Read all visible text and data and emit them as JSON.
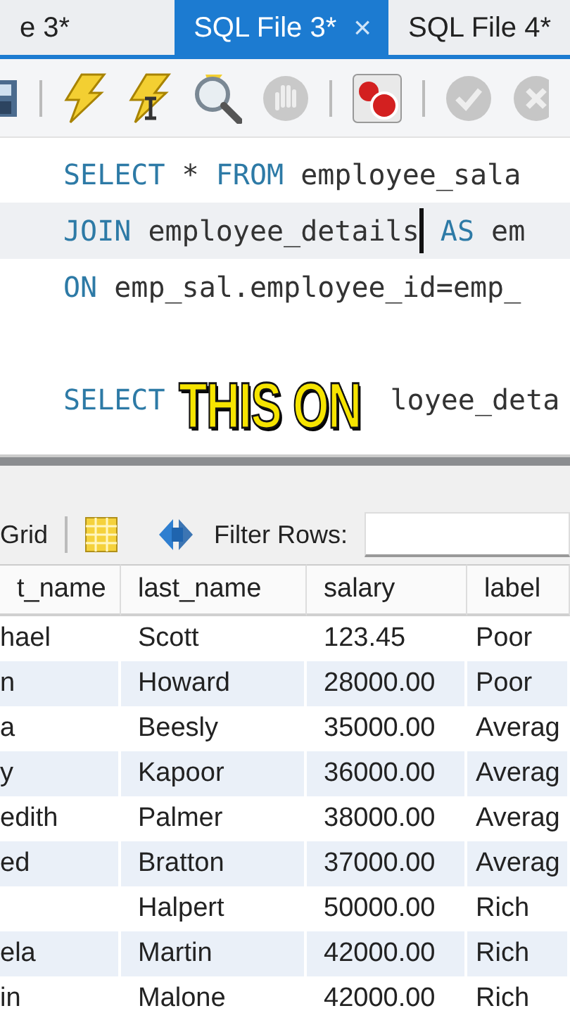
{
  "tabs": [
    {
      "label": "e 3*",
      "selected": false,
      "closable": false
    },
    {
      "label": "SQL File 3*",
      "selected": true,
      "closable": true
    },
    {
      "label": "SQL File 4*",
      "selected": false,
      "closable": false
    }
  ],
  "close_glyph": "×",
  "editor": {
    "lines": [
      {
        "current": false,
        "tokens": [
          {
            "kind": "keyword",
            "text": "SELECT"
          },
          {
            "kind": "plain",
            "text": " * "
          },
          {
            "kind": "keyword",
            "text": "FROM"
          },
          {
            "kind": "plain",
            "text": " employee_sala"
          }
        ]
      },
      {
        "current": true,
        "tokens": [
          {
            "kind": "keyword",
            "text": "JOIN"
          },
          {
            "kind": "plain",
            "text": " employee_details"
          },
          {
            "kind": "caret"
          },
          {
            "kind": "keyword",
            "text": " AS"
          },
          {
            "kind": "plain",
            "text": " em"
          }
        ]
      },
      {
        "current": false,
        "tokens": [
          {
            "kind": "keyword",
            "text": "ON"
          },
          {
            "kind": "plain",
            "text": " emp_sal.employee_id=emp_"
          }
        ]
      },
      {
        "current": false,
        "tokens": [
          {
            "kind": "keyword",
            "text": "SELECT"
          },
          {
            "kind": "gap"
          },
          {
            "kind": "plain",
            "text": "loyee_deta"
          }
        ]
      }
    ]
  },
  "caption": "THIS ON",
  "results": {
    "view_label": "Grid",
    "filter_label": "Filter Rows:",
    "columns": [
      "t_name",
      "last_name",
      "salary",
      "label"
    ],
    "rows": [
      [
        "hael",
        "Scott",
        "123.45",
        "Poor"
      ],
      [
        "n",
        "Howard",
        "28000.00",
        "Poor"
      ],
      [
        "a",
        "Beesly",
        "35000.00",
        "Averag"
      ],
      [
        "y",
        "Kapoor",
        "36000.00",
        "Averag"
      ],
      [
        "edith",
        "Palmer",
        "38000.00",
        "Averag"
      ],
      [
        "ed",
        "Bratton",
        "37000.00",
        "Averag"
      ],
      [
        "",
        "Halpert",
        "50000.00",
        "Rich"
      ],
      [
        "ela",
        "Martin",
        "42000.00",
        "Rich"
      ],
      [
        "in",
        "Malone",
        "42000.00",
        "Rich"
      ]
    ]
  }
}
